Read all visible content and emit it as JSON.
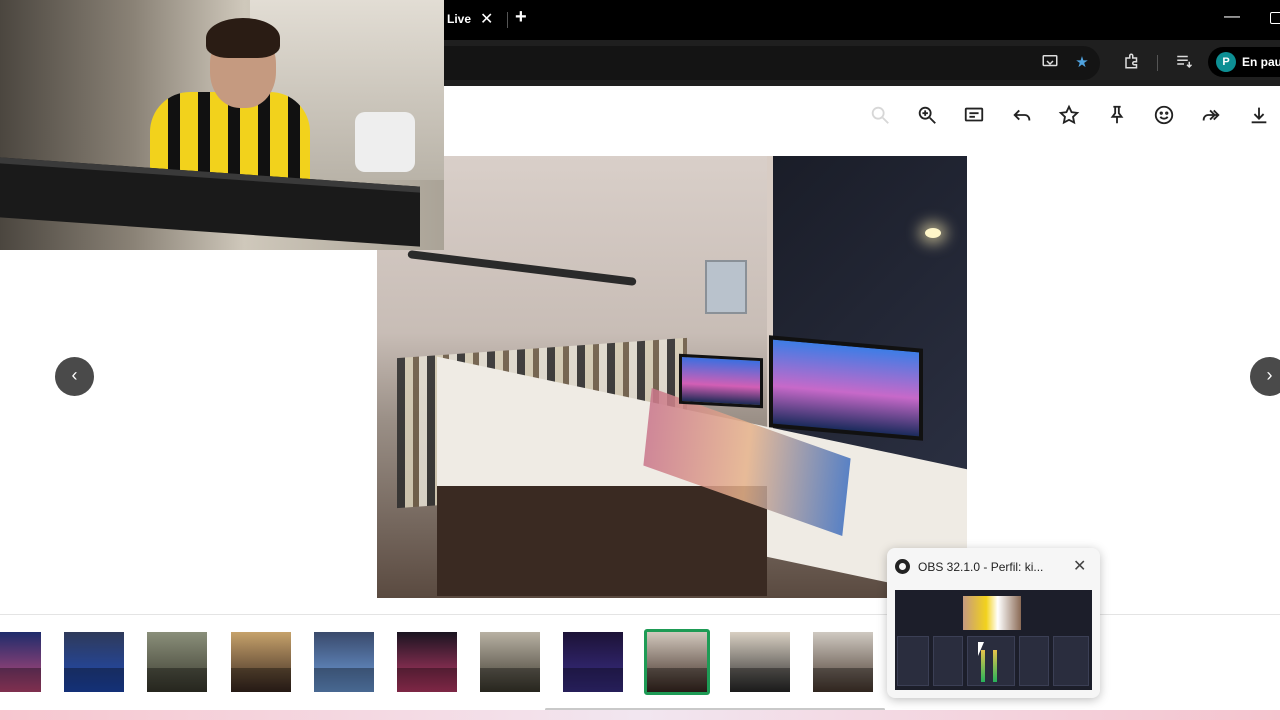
{
  "browser": {
    "tab_title": "Live",
    "tab_close_icon": "close-icon",
    "new_tab_label": "+",
    "profile": {
      "initial": "P",
      "label": "En paus"
    }
  },
  "toolbar_icons": [
    "screen-cast-icon",
    "star-filled-icon",
    "extensions-icon",
    "reading-list-icon"
  ],
  "viewer_toolbar": [
    "zoom-out-icon",
    "zoom-in-icon",
    "captions-icon",
    "reply-icon",
    "star-icon",
    "pin-icon",
    "emoji-icon",
    "forward-icon",
    "download-icon"
  ],
  "navigation": {
    "prev_label": "‹",
    "next_label": "›"
  },
  "filmstrip": {
    "thumbnails": [
      {
        "name": "thumb-1",
        "colors": [
          "#1e2c6b",
          "#c44a7a"
        ]
      },
      {
        "name": "thumb-2",
        "colors": [
          "#2f3a5a",
          "#1e4bb8"
        ]
      },
      {
        "name": "thumb-3",
        "colors": [
          "#8a8f7a",
          "#3b3b2f"
        ]
      },
      {
        "name": "thumb-4",
        "colors": [
          "#c6a26b",
          "#3a2820"
        ]
      },
      {
        "name": "thumb-5",
        "colors": [
          "#3a4a6b",
          "#6fa0e0"
        ]
      },
      {
        "name": "thumb-6",
        "colors": [
          "#1a1420",
          "#c23c6b"
        ]
      },
      {
        "name": "thumb-7",
        "colors": [
          "#b8b1a3",
          "#3d3a2f"
        ]
      },
      {
        "name": "thumb-8",
        "colors": [
          "#1c1236",
          "#3b2f8a"
        ]
      },
      {
        "name": "thumb-9",
        "colors": [
          "#d2c8bd",
          "#3c2a22"
        ],
        "selected": true
      },
      {
        "name": "thumb-10",
        "colors": [
          "#d8cfc2",
          "#2a2a2a"
        ]
      },
      {
        "name": "thumb-11",
        "colors": [
          "#cfc9c1",
          "#4a3a30"
        ]
      }
    ]
  },
  "obs_card": {
    "title": "OBS 32.1.0 - Perfil: ki...",
    "close_icon": "close-icon"
  },
  "colors": {
    "titlebar": "#000000",
    "toolbar": "#1f1f1f",
    "selected_thumb_border": "#1e9b55",
    "profile_avatar": "#0d8f94",
    "star_active": "#4fa3e0"
  }
}
